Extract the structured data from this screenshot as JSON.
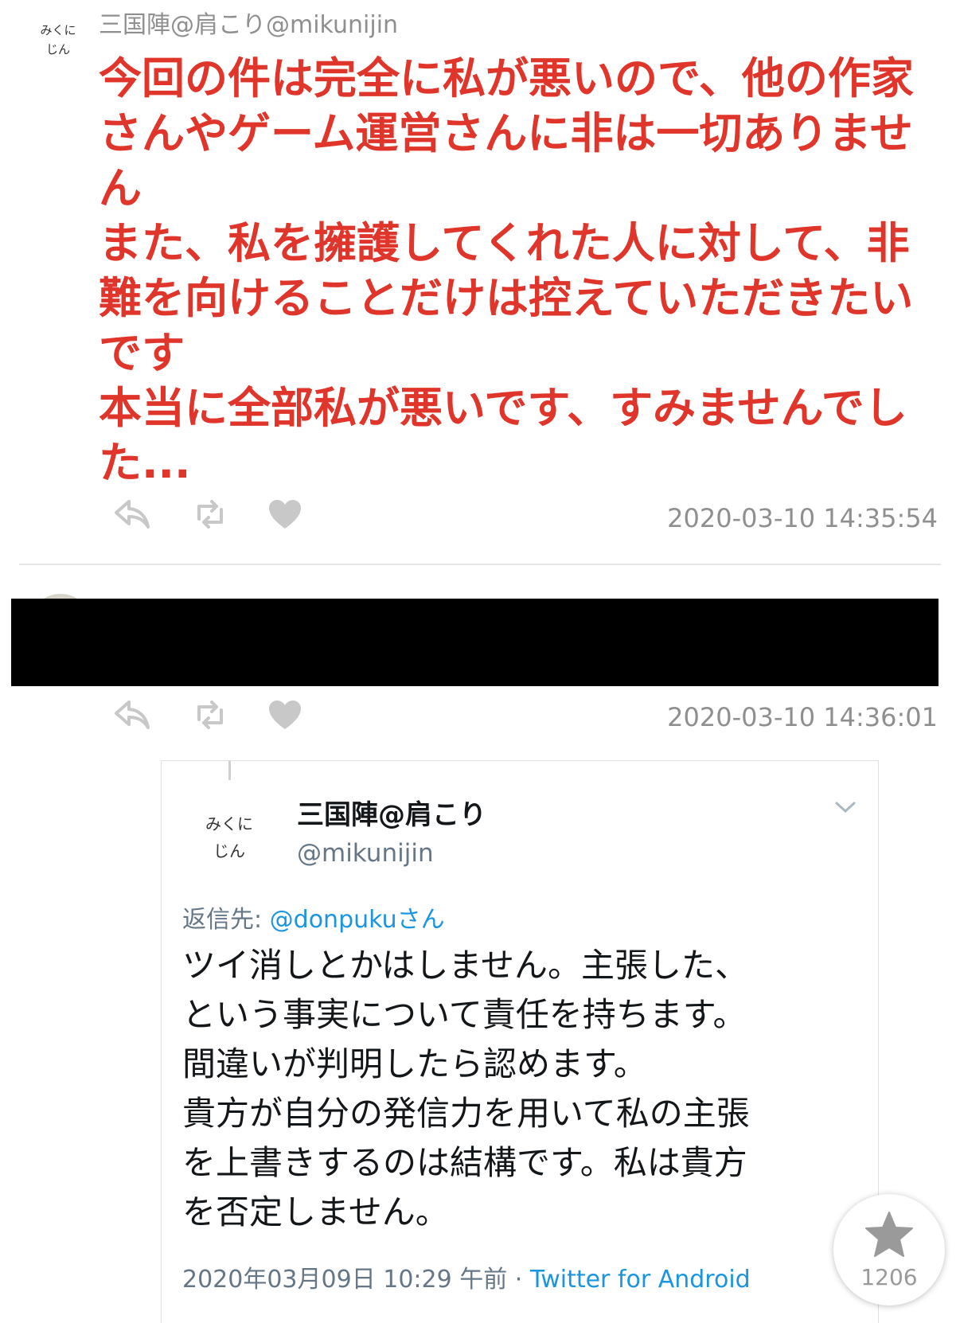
{
  "tweet1": {
    "avatar_text": [
      "みくに",
      "じん"
    ],
    "author_line": "三国陣@肩こり@mikunijin",
    "body_lines": [
      "今回の件は完全に私が悪いので、他の作家",
      "さんやゲーム運営さんに非は一切ありませ",
      "ん",
      "また、私を擁護してくれた人に対して、非",
      "難を向けることだけは控えていただきたい",
      "です",
      "本当に全部私が悪いです、すみませんでし",
      "た..."
    ],
    "timestamp": "2020-03-10 14:35:54",
    "actions": [
      "reply-icon",
      "retweet-icon",
      "heart-icon"
    ]
  },
  "tweet2": {
    "timestamp": "2020-03-10 14:36:01",
    "actions": [
      "reply-icon",
      "retweet-icon",
      "heart-icon"
    ]
  },
  "embedded": {
    "avatar_text": [
      "みくに",
      "じん"
    ],
    "name": "三国陣@肩こり",
    "handle": "@mikunijin",
    "reply_prefix": "返信先: ",
    "reply_mention": "@donpukuさん",
    "body_lines": [
      "ツイ消しとかはしません。主張した、",
      "という事実について責任を持ちます。",
      "間違いが判明したら認めます。",
      "貴方が自分の発信力を用いて私の主張",
      "を上書きするのは結構です。私は貴方",
      "を否定しません。"
    ],
    "date": "2020年03月09日 10:29 午前",
    "separator": " · ",
    "client": "Twitter for Android"
  },
  "fav_button": {
    "icon": "star-icon",
    "count": "1206"
  },
  "colors": {
    "highlight_red": "#e0352b",
    "link_blue": "#1b95e0",
    "meta_gray": "#8f8f8f"
  }
}
